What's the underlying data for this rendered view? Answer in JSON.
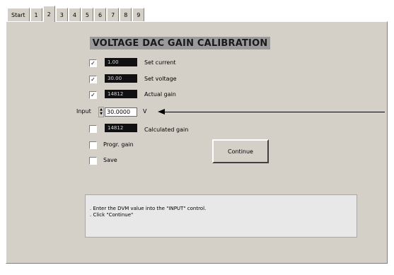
{
  "tabs": [
    "Start",
    "1",
    "2",
    "3",
    "4",
    "5",
    "6",
    "7",
    "8",
    "9"
  ],
  "active_tab": "2",
  "heading": "VOLTAGE DAC GAIN CALIBRATION",
  "rows": [
    {
      "checked": "✓",
      "value": "1.00",
      "label": "Set current"
    },
    {
      "checked": "✓",
      "value": "30.00",
      "label": "Set voltage"
    },
    {
      "checked": "✓",
      "value": "14812",
      "label": "Actual gain"
    }
  ],
  "input": {
    "label": "Input",
    "value": "30.0000",
    "unit": "V"
  },
  "calculated": {
    "checked": "",
    "value": "14812",
    "label": "Calculated gain"
  },
  "prog_gain": {
    "checked": "",
    "label": "Progr. gain"
  },
  "save": {
    "checked": "",
    "label": "Save"
  },
  "continue_label": "Continue",
  "message": [
    ". Enter the DVM value into the \"INPUT\" control.",
    ". Click \"Continue\""
  ],
  "colors": {
    "panel": "#d4d0c8",
    "indicator": "#111111",
    "heading_bg": "#9a9a9a"
  }
}
